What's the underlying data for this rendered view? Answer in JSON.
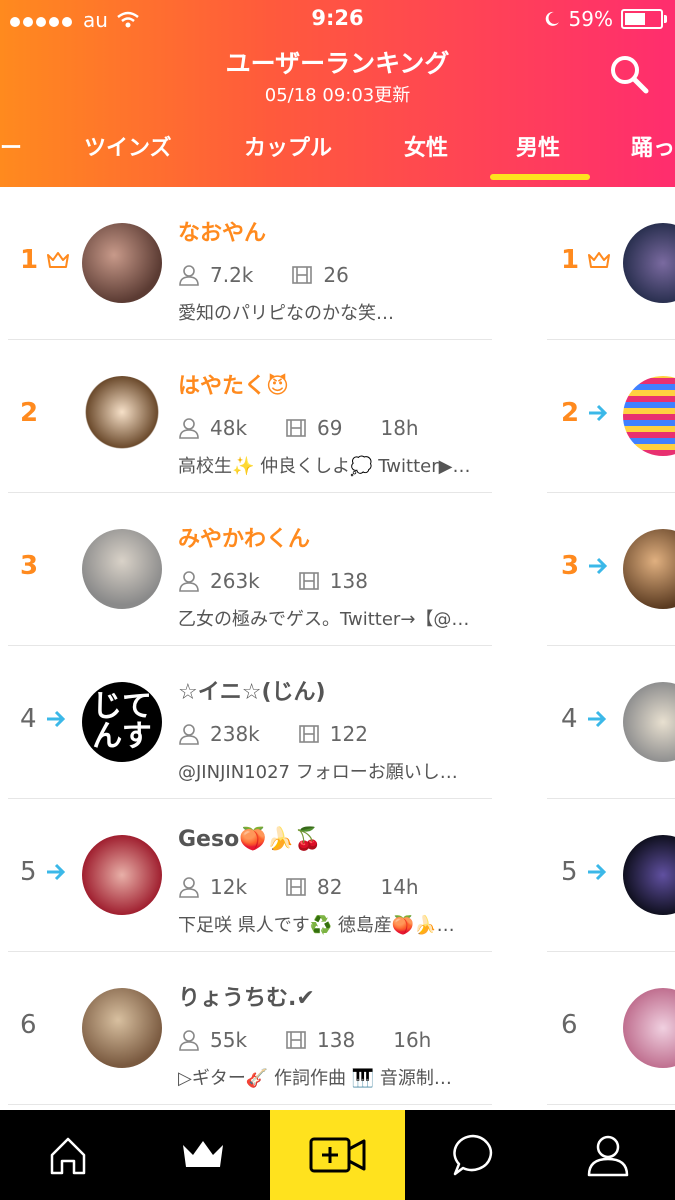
{
  "status": {
    "carrier": "au",
    "time": "9:26",
    "battery": "59%",
    "battery_level": 0.59
  },
  "header": {
    "title": "ユーザーランキング",
    "updated": "05/18 09:03更新"
  },
  "tabs": [
    "ー",
    "ツインズ",
    "カップル",
    "女性",
    "男性",
    "踊っ"
  ],
  "active_tab": "男性",
  "rankings": [
    {
      "rank": "1",
      "name": "なおやん",
      "followers": "7.2k",
      "videos": "26",
      "time": "",
      "bio": "愛知のパリピなのかな笑…",
      "indicator": "crown"
    },
    {
      "rank": "2",
      "name": "はやたく😈",
      "followers": "48k",
      "videos": "69",
      "time": "18h",
      "bio": "高校生✨ 仲良くしよ💭 Twitter▶…",
      "indicator": "none"
    },
    {
      "rank": "3",
      "name": "みやかわくん",
      "followers": "263k",
      "videos": "138",
      "time": "",
      "bio": "乙女の極みでゲス。Twitter→【@…",
      "indicator": "none"
    },
    {
      "rank": "4",
      "name": "☆イニ☆(じん)",
      "followers": "238k",
      "videos": "122",
      "time": "",
      "bio": "@JINJIN1027 フォローお願いし…",
      "indicator": "arrow"
    },
    {
      "rank": "5",
      "name": "Geso🍑🍌🍒",
      "followers": "12k",
      "videos": "82",
      "time": "14h",
      "bio": "下足咲 県人です♻️ 徳島産🍑🍌…",
      "indicator": "arrow"
    },
    {
      "rank": "6",
      "name": "りょうちむ.✔",
      "followers": "55k",
      "videos": "138",
      "time": "16h",
      "bio": "▷ギター🎸 作詞作曲 🎹 音源制…",
      "indicator": "none"
    }
  ],
  "right_column": [
    {
      "rank": "1",
      "indicator": "crown"
    },
    {
      "rank": "2",
      "indicator": "arrow"
    },
    {
      "rank": "3",
      "indicator": "arrow"
    },
    {
      "rank": "4",
      "indicator": "arrow"
    },
    {
      "rank": "5",
      "indicator": "arrow"
    },
    {
      "rank": "6",
      "indicator": "none"
    }
  ],
  "tabbar": [
    "home-icon",
    "crown-icon",
    "video-add-icon",
    "chat-icon",
    "profile-icon"
  ],
  "colors": {
    "accent_orange": "#ff8a1e",
    "accent_pink": "#ff2d6e",
    "highlight": "#ffe21e",
    "arrow": "#3bb8e8"
  }
}
